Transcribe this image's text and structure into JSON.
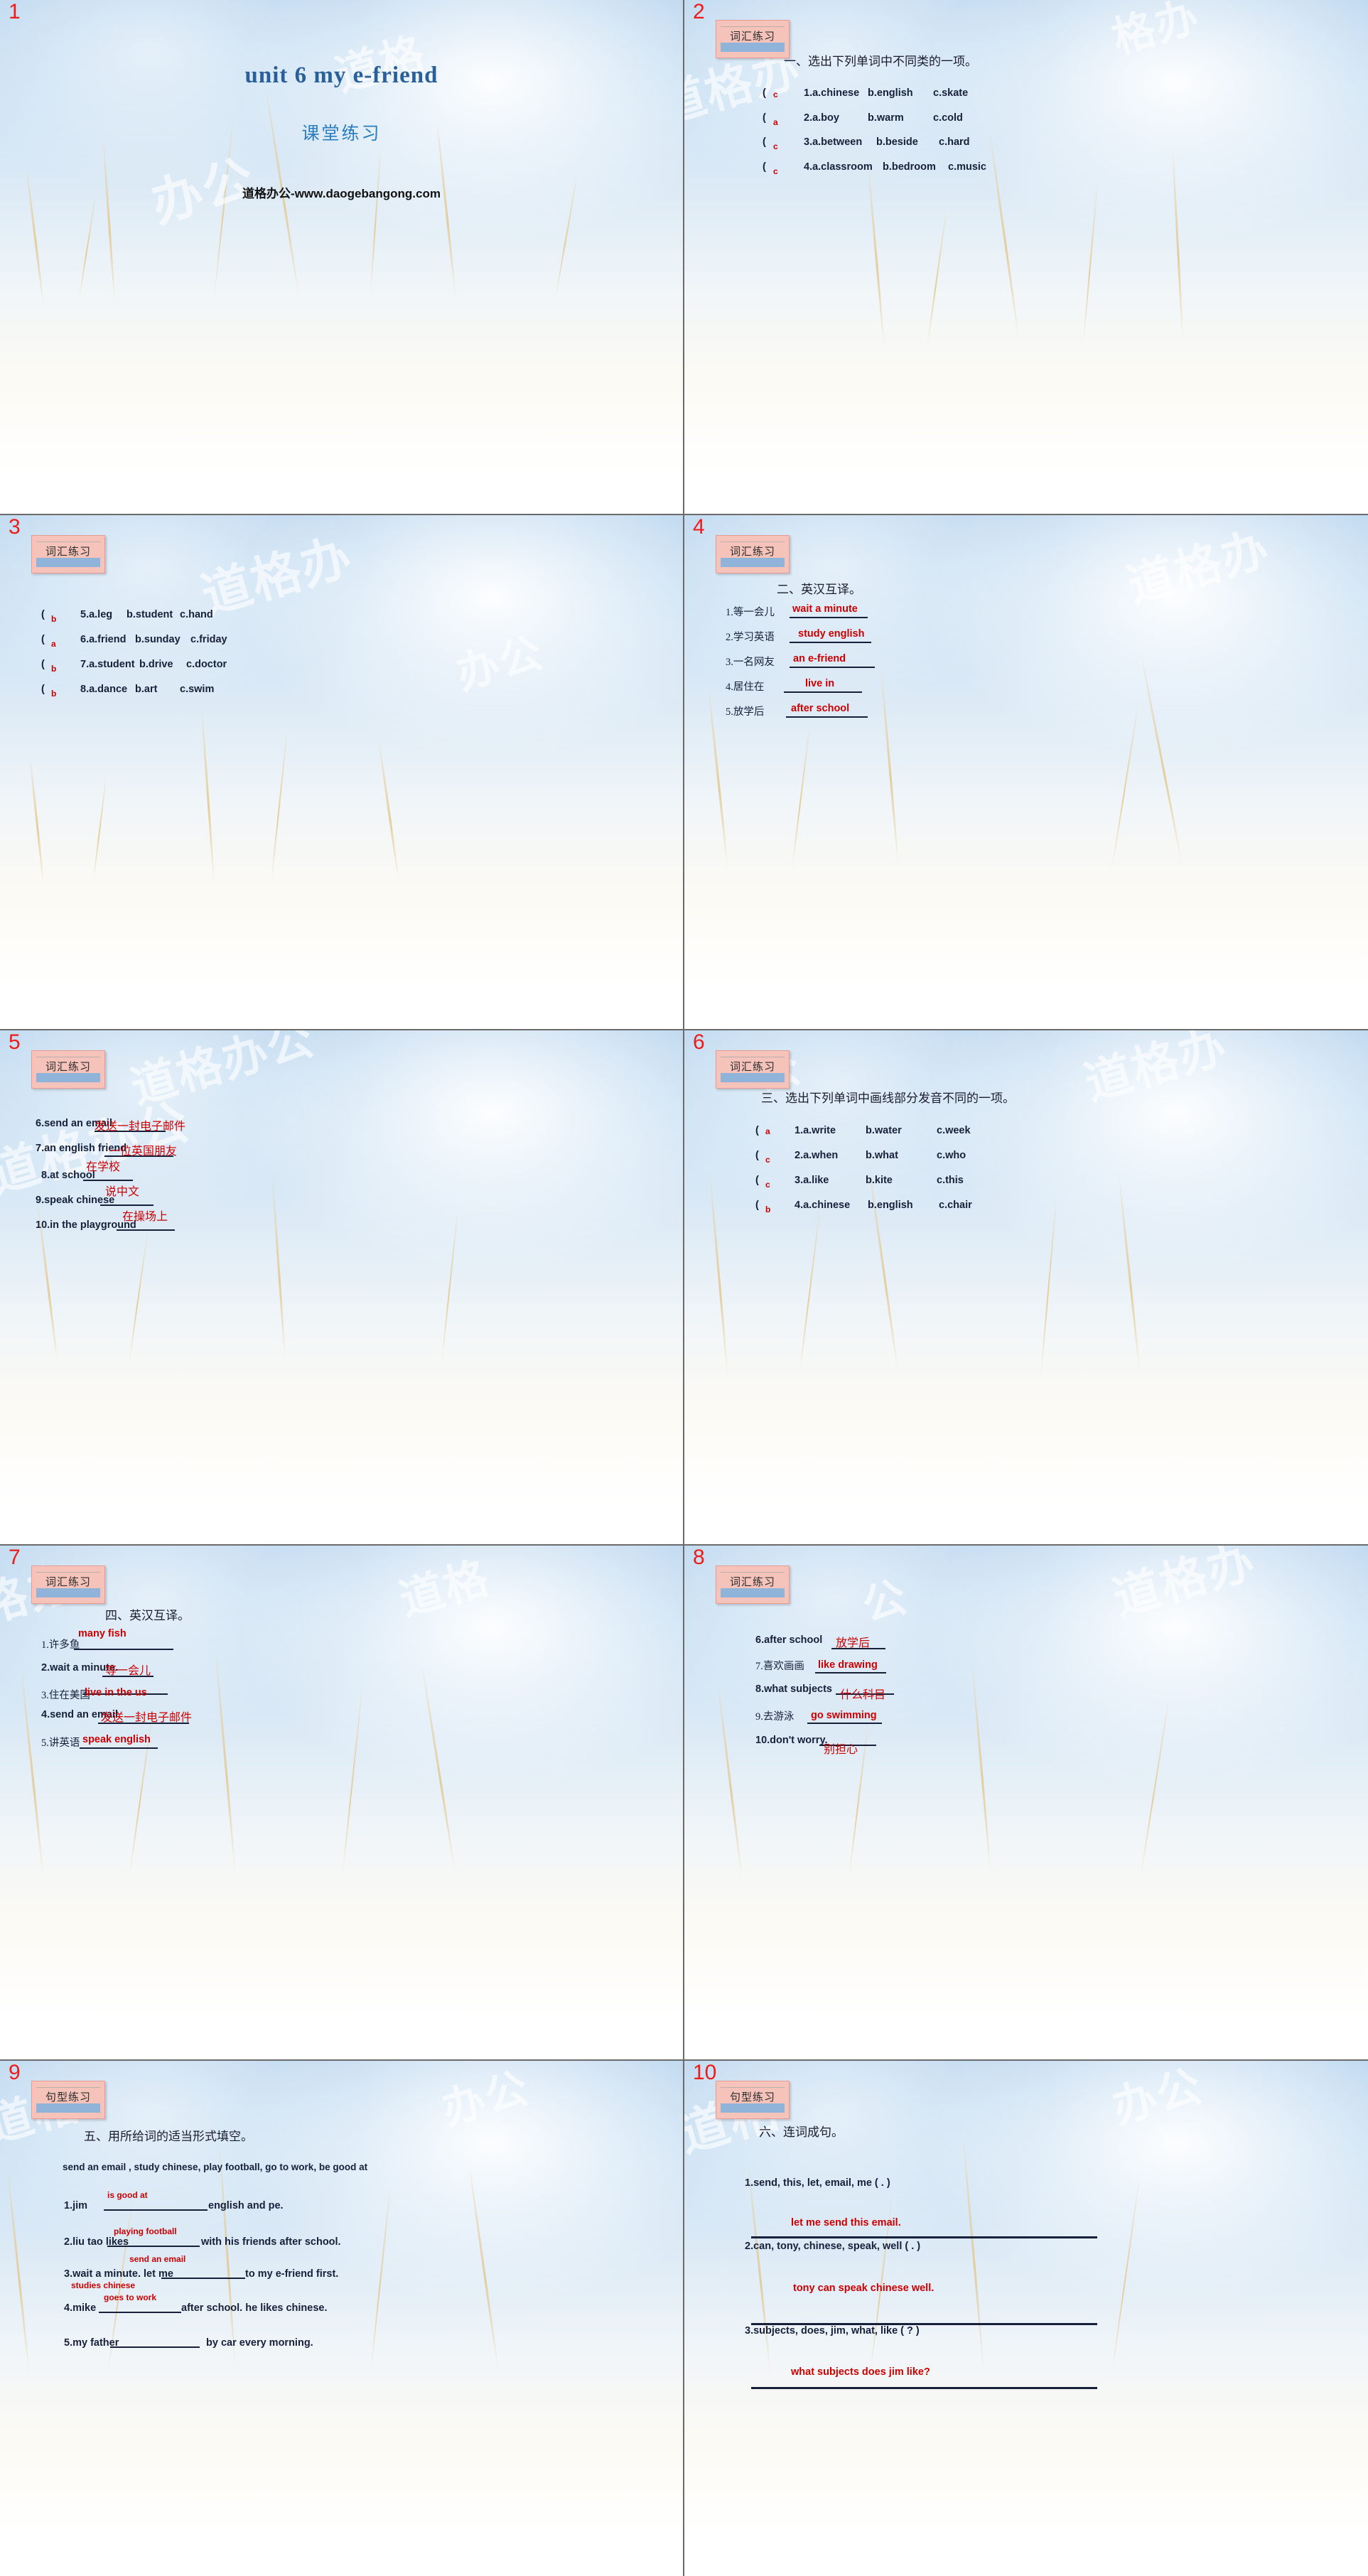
{
  "meta": {
    "colors": {
      "answer_red": "#cc0000",
      "slide_number": "#ee1b1b",
      "title_blue": "#2a6099",
      "tag_pink": "#f6c3bb"
    },
    "watermark": "道格办公"
  },
  "slides": [
    {
      "number": "1",
      "title": "unit 6  my e-friend",
      "subtitle": "课堂练习",
      "brand": "道格办公-www.daogebangong.com"
    },
    {
      "number": "2",
      "tag": "词汇练习",
      "heading": "一、选出下列单词中不同类的一项。",
      "items": [
        {
          "answer": "c",
          "text": "1.a.chinese",
          "b": "b.english",
          "c": "c.skate"
        },
        {
          "answer": "a",
          "text": "2.a.boy",
          "b": "b.warm",
          "c": "c.cold"
        },
        {
          "answer": "c",
          "text": "3.a.between",
          "b": "b.beside",
          "c": "c.hard"
        },
        {
          "answer": "c",
          "text": "4.a.classroom",
          "b": "b.bedroom",
          "c": "c.music"
        }
      ]
    },
    {
      "number": "3",
      "tag": "词汇练习",
      "items": [
        {
          "answer": "b",
          "text": "5.a.leg",
          "b": "b.student",
          "c": "c.hand"
        },
        {
          "answer": "a",
          "text": "6.a.friend",
          "b": "b.sunday",
          "c": "c.friday"
        },
        {
          "answer": "b",
          "text": "7.a.student",
          "b": "b.drive",
          "c": "c.doctor"
        },
        {
          "answer": "b",
          "text": "8.a.dance",
          "b": "b.art",
          "c": "c.swim"
        }
      ]
    },
    {
      "number": "4",
      "tag": "词汇练习",
      "heading": "二、英汉互译。",
      "items": [
        {
          "prompt": "1.等一会儿",
          "answer": "wait a minute"
        },
        {
          "prompt": "2.学习英语",
          "answer": "study english"
        },
        {
          "prompt": "3.一名网友",
          "answer": "an e-friend"
        },
        {
          "prompt": "4.居住在",
          "answer": "live in"
        },
        {
          "prompt": "5.放学后",
          "answer": "after school"
        }
      ]
    },
    {
      "number": "5",
      "tag": "词汇练习",
      "items": [
        {
          "prompt": "6.send an email",
          "answer": "发送一封电子邮件"
        },
        {
          "prompt": "7.an english friend",
          "answer": "一位英国朋友"
        },
        {
          "prompt": "8.at school",
          "answer": "在学校"
        },
        {
          "prompt": "9.speak chinese",
          "answer": "说中文"
        },
        {
          "prompt": "10.in the playground",
          "answer": "在操场上"
        }
      ]
    },
    {
      "number": "6",
      "tag": "词汇练习",
      "heading": "三、选出下列单词中画线部分发音不同的一项。",
      "items": [
        {
          "answer": "a",
          "text": "1.a.write",
          "b": "b.water",
          "c": "c.week"
        },
        {
          "answer": "c",
          "text": "2.a.when",
          "b": "b.what",
          "c": "c.who"
        },
        {
          "answer": "c",
          "text": "3.a.like",
          "b": "b.kite",
          "c": "c.this"
        },
        {
          "answer": "b",
          "text": "4.a.chinese",
          "b": "b.english",
          "c": "c.chair"
        }
      ]
    },
    {
      "number": "7",
      "tag": "词汇练习",
      "heading": "四、英汉互译。",
      "items": [
        {
          "prompt": "1.许多鱼",
          "answer": "many fish"
        },
        {
          "prompt": "2.wait a minute.",
          "answer": "等一会儿"
        },
        {
          "prompt": "3.住在美国",
          "answer": "live in the us"
        },
        {
          "prompt": "4.send an email",
          "answer": "发送一封电子邮件"
        },
        {
          "prompt": "5.讲英语",
          "answer": "speak english"
        }
      ]
    },
    {
      "number": "8",
      "tag": "词汇练习",
      "items": [
        {
          "prompt": "6.after school",
          "answer": "放学后"
        },
        {
          "prompt": "7.喜欢画画",
          "answer": "like drawing"
        },
        {
          "prompt": "8.what subjects",
          "answer": "什么科目"
        },
        {
          "prompt": "9.去游泳",
          "answer": "go swimming"
        },
        {
          "prompt": "10.don't worry.",
          "answer": "别担心"
        }
      ]
    },
    {
      "number": "9",
      "tag": "句型练习",
      "heading": "五、用所给词的适当形式填空。",
      "wordbank": "send an email ,   study chinese,  play football, go to work, be good at",
      "items": [
        {
          "pre": "1.jim",
          "post": "english and pe.",
          "answer": "is good at"
        },
        {
          "pre": "2.liu tao likes",
          "post": "with  his friends after school.",
          "answer": "playing football"
        },
        {
          "pre": "3.wait a minute. let me",
          "post": "to  my e-friend first.",
          "answer": "send an email"
        },
        {
          "pre": "4.mike",
          "post": "after  school. he likes chinese.",
          "answer": "goes to work"
        },
        {
          "pre": "5.my father",
          "post": "by car every morning.",
          "answer": "studies chinese"
        }
      ]
    },
    {
      "number": "10",
      "tag": "句型练习",
      "heading": "六、连词成句。",
      "items": [
        {
          "prompt": "1.send, this, let, email, me ( . )",
          "answer": "let me send this email."
        },
        {
          "prompt": "2.can, tony, chinese, speak, well ( . )",
          "answer": "tony can speak chinese well."
        },
        {
          "prompt": "3.subjects, does, jim, what, like  ( ? )",
          "answer": "what subjects does jim like?"
        }
      ]
    }
  ]
}
